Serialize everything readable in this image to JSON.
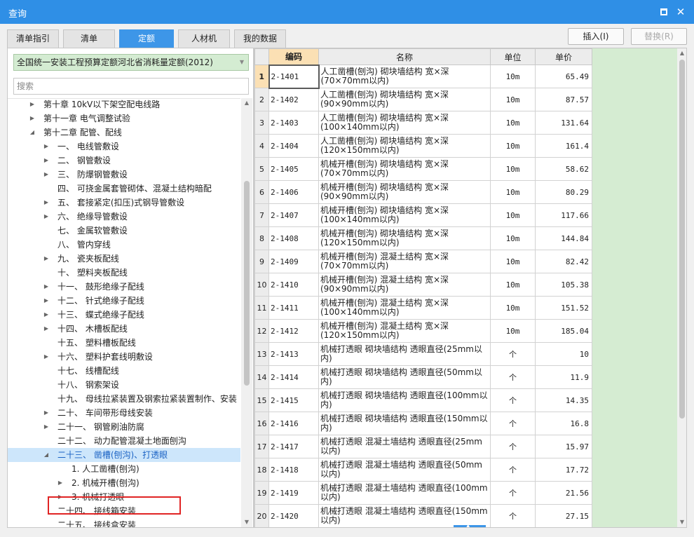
{
  "window": {
    "title": "查询",
    "maximize_icon": "maximize-icon",
    "close_label": "✕",
    "close_icon": "close-icon"
  },
  "tabs": [
    {
      "label": "清单指引",
      "active": false
    },
    {
      "label": "清单",
      "active": false
    },
    {
      "label": "定额",
      "active": true
    },
    {
      "label": "人材机",
      "active": false
    },
    {
      "label": "我的数据",
      "active": false
    }
  ],
  "toolbar": {
    "insert_label": "插入(I)",
    "replace_label": "替换(R)"
  },
  "left": {
    "quota_library": "全国统一安装工程预算定额河北省消耗量定额(2012)",
    "search": {
      "value": "",
      "placeholder": "搜索"
    }
  },
  "tree": [
    {
      "label": "第十章 10kV以下架空配电线路",
      "toggle": "▶",
      "level": 0
    },
    {
      "label": "第十一章 电气调整试验",
      "toggle": "▶",
      "level": 0
    },
    {
      "label": "第十二章 配管、配线",
      "toggle": "◢",
      "level": 0
    },
    {
      "label": "一、 电线管敷设",
      "toggle": "▶",
      "level": 1
    },
    {
      "label": "二、 钢管敷设",
      "toggle": "▶",
      "level": 1
    },
    {
      "label": "三、 防爆钢管敷设",
      "toggle": "▶",
      "level": 1
    },
    {
      "label": "四、 可挠金属套管砌体、混凝土结构暗配",
      "toggle": "",
      "level": 1
    },
    {
      "label": "五、 套接紧定(扣压)式钢导管敷设",
      "toggle": "▶",
      "level": 1
    },
    {
      "label": "六、 绝缘导管敷设",
      "toggle": "▶",
      "level": 1
    },
    {
      "label": "七、 金属软管敷设",
      "toggle": "",
      "level": 1
    },
    {
      "label": "八、 管内穿线",
      "toggle": "",
      "level": 1
    },
    {
      "label": "九、 瓷夹板配线",
      "toggle": "▶",
      "level": 1
    },
    {
      "label": "十、 塑料夹板配线",
      "toggle": "",
      "level": 1
    },
    {
      "label": "十一、 鼓形绝缘子配线",
      "toggle": "▶",
      "level": 1
    },
    {
      "label": "十二、 针式绝缘子配线",
      "toggle": "▶",
      "level": 1
    },
    {
      "label": "十三、 蝶式绝缘子配线",
      "toggle": "▶",
      "level": 1
    },
    {
      "label": "十四、 木槽板配线",
      "toggle": "▶",
      "level": 1
    },
    {
      "label": "十五、 塑料槽板配线",
      "toggle": "",
      "level": 1
    },
    {
      "label": "十六、 塑料护套线明敷设",
      "toggle": "▶",
      "level": 1
    },
    {
      "label": "十七、 线槽配线",
      "toggle": "",
      "level": 1
    },
    {
      "label": "十八、 钢索架设",
      "toggle": "",
      "level": 1
    },
    {
      "label": "十九、 母线拉紧装置及钢索拉紧装置制作、安装",
      "toggle": "",
      "level": 1
    },
    {
      "label": "二十、 车间带形母线安装",
      "toggle": "▶",
      "level": 1
    },
    {
      "label": "二十一、 钢管刷油防腐",
      "toggle": "▶",
      "level": 1
    },
    {
      "label": "二十二、 动力配管混凝土地面刨沟",
      "toggle": "",
      "level": 1
    },
    {
      "label": "二十三、 凿槽(刨沟)、打透眼",
      "toggle": "◢",
      "level": 1,
      "selected": true
    },
    {
      "label": "1. 人工凿槽(刨沟)",
      "toggle": "",
      "level": 2
    },
    {
      "label": "2. 机械开槽(刨沟)",
      "toggle": "▶",
      "level": 2
    },
    {
      "label": "3. 机械打透眼",
      "toggle": "▶",
      "level": 2
    },
    {
      "label": "二十四、 接线箱安装",
      "toggle": "",
      "level": 1
    },
    {
      "label": "二十五、 接线盒安装",
      "toggle": "",
      "level": 1
    }
  ],
  "grid": {
    "headers": {
      "code": "编码",
      "name": "名称",
      "unit": "单位",
      "price": "单价"
    },
    "rows": [
      {
        "no": "1",
        "code": "2-1401",
        "name": "人工凿槽(刨沟) 砌块墙结构 宽×深(70×70mm以内)",
        "unit": "10m",
        "price": "65.49",
        "current": true
      },
      {
        "no": "2",
        "code": "2-1402",
        "name": "人工凿槽(刨沟) 砌块墙结构 宽×深(90×90mm以内)",
        "unit": "10m",
        "price": "87.57"
      },
      {
        "no": "3",
        "code": "2-1403",
        "name": "人工凿槽(刨沟) 砌块墙结构 宽×深(100×140mm以内)",
        "unit": "10m",
        "price": "131.64"
      },
      {
        "no": "4",
        "code": "2-1404",
        "name": "人工凿槽(刨沟) 砌块墙结构 宽×深(120×150mm以内)",
        "unit": "10m",
        "price": "161.4"
      },
      {
        "no": "5",
        "code": "2-1405",
        "name": "机械开槽(刨沟) 砌块墙结构 宽×深(70×70mm以内)",
        "unit": "10m",
        "price": "58.62"
      },
      {
        "no": "6",
        "code": "2-1406",
        "name": "机械开槽(刨沟) 砌块墙结构 宽×深(90×90mm以内)",
        "unit": "10m",
        "price": "80.29"
      },
      {
        "no": "7",
        "code": "2-1407",
        "name": "机械开槽(刨沟) 砌块墙结构 宽×深(100×140mm以内)",
        "unit": "10m",
        "price": "117.66"
      },
      {
        "no": "8",
        "code": "2-1408",
        "name": "机械开槽(刨沟) 砌块墙结构 宽×深(120×150mm以内)",
        "unit": "10m",
        "price": "144.84"
      },
      {
        "no": "9",
        "code": "2-1409",
        "name": "机械开槽(刨沟) 混凝土结构 宽×深(70×70mm以内)",
        "unit": "10m",
        "price": "82.42"
      },
      {
        "no": "10",
        "code": "2-1410",
        "name": "机械开槽(刨沟) 混凝土结构 宽×深(90×90mm以内)",
        "unit": "10m",
        "price": "105.38"
      },
      {
        "no": "11",
        "code": "2-1411",
        "name": "机械开槽(刨沟) 混凝土结构 宽×深(100×140mm以内)",
        "unit": "10m",
        "price": "151.52"
      },
      {
        "no": "12",
        "code": "2-1412",
        "name": "机械开槽(刨沟) 混凝土结构 宽×深(120×150mm以内)",
        "unit": "10m",
        "price": "185.04"
      },
      {
        "no": "13",
        "code": "2-1413",
        "name": "机械打透眼 砌块墙结构 透眼直径(25mm以内)",
        "unit": "个",
        "price": "10"
      },
      {
        "no": "14",
        "code": "2-1414",
        "name": "机械打透眼 砌块墙结构 透眼直径(50mm以内)",
        "unit": "个",
        "price": "11.9"
      },
      {
        "no": "15",
        "code": "2-1415",
        "name": "机械打透眼 砌块墙结构 透眼直径(100mm以内)",
        "unit": "个",
        "price": "14.35"
      },
      {
        "no": "16",
        "code": "2-1416",
        "name": "机械打透眼 砌块墙结构 透眼直径(150mm以内)",
        "unit": "个",
        "price": "16.8"
      },
      {
        "no": "17",
        "code": "2-1417",
        "name": "机械打透眼 混凝土墙结构 透眼直径(25mm以内)",
        "unit": "个",
        "price": "15.97"
      },
      {
        "no": "18",
        "code": "2-1418",
        "name": "机械打透眼 混凝土墙结构 透眼直径(50mm以内)",
        "unit": "个",
        "price": "17.72"
      },
      {
        "no": "19",
        "code": "2-1419",
        "name": "机械打透眼 混凝土墙结构 透眼直径(100mm以内)",
        "unit": "个",
        "price": "21.56"
      },
      {
        "no": "20",
        "code": "2-1420",
        "name": "机械打透眼 混凝土墙结构 透眼直径(150mm以内)",
        "unit": "个",
        "price": "27.15"
      }
    ]
  },
  "colors": {
    "titlebar": "#2f8fe6",
    "active_tab": "#3d96e8",
    "selection_box": "#e02424",
    "green_fill": "#d5ecd2",
    "header_highlight": "#fbe0b4"
  }
}
